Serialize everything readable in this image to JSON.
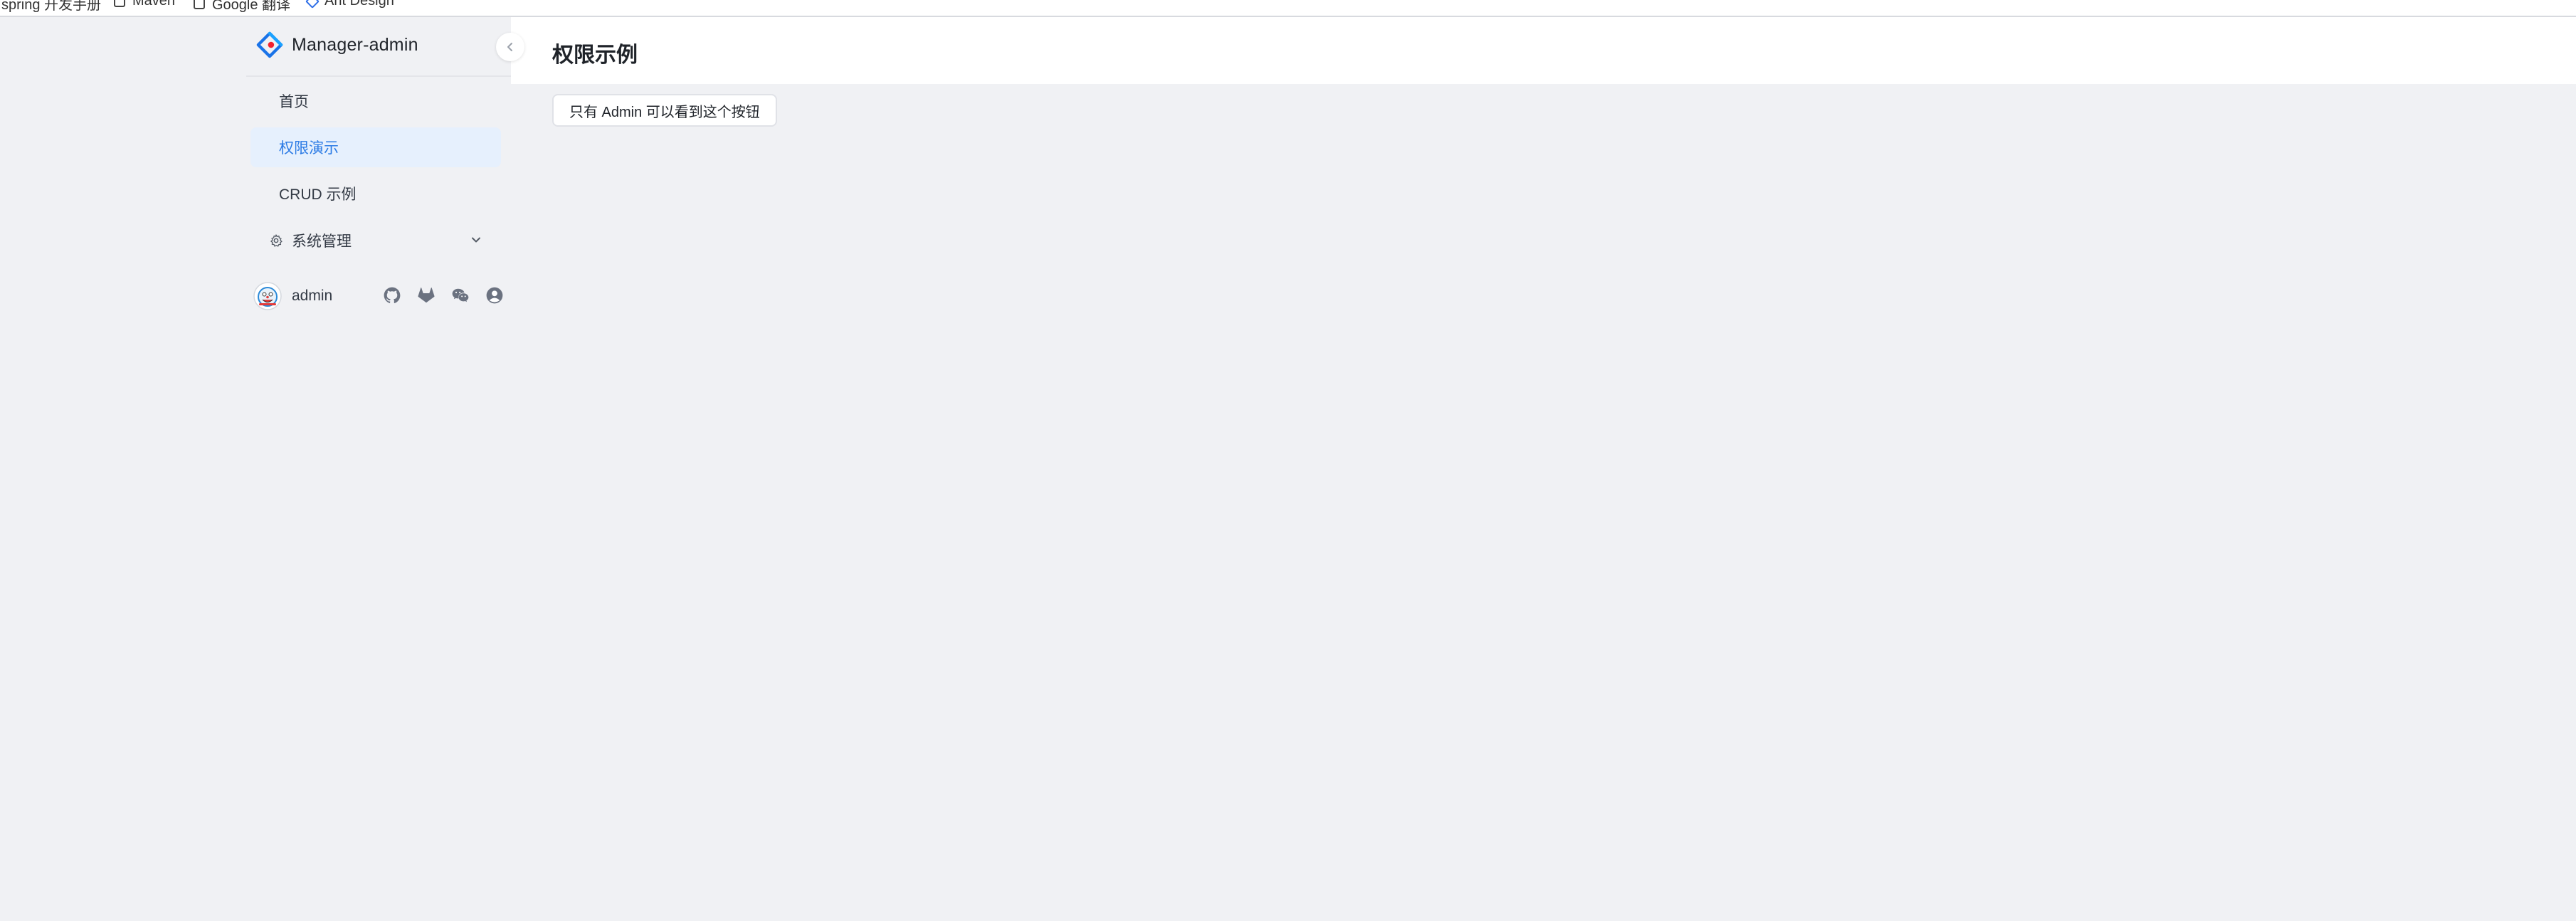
{
  "browser": {
    "bookmarks": [
      {
        "label": "spring 开发手册",
        "icon": "folder-icon"
      },
      {
        "label": "Maven",
        "icon": "page-icon"
      },
      {
        "label": "Google 翻译",
        "icon": "page-icon"
      },
      {
        "label": "Ant Design",
        "icon": "ant-design-icon"
      }
    ]
  },
  "sidebar": {
    "logo_text": "Manager-admin",
    "menu": [
      {
        "label": "首页",
        "active": false
      },
      {
        "label": "权限演示",
        "active": true
      },
      {
        "label": "CRUD 示例",
        "active": false
      }
    ],
    "group": {
      "label": "系统管理",
      "icon": "gear-icon",
      "expanded": false
    },
    "user": {
      "name": "admin"
    },
    "social_icons": [
      "github-icon",
      "gitlab-icon",
      "wechat-icon",
      "user-circle-icon"
    ]
  },
  "main": {
    "title": "权限示例",
    "admin_button_label": "只有 Admin 可以看到这个按钮"
  },
  "colors": {
    "accent": "#2c7be5",
    "active_bg": "#e6f0fd",
    "page_bg": "#f0f1f4"
  }
}
